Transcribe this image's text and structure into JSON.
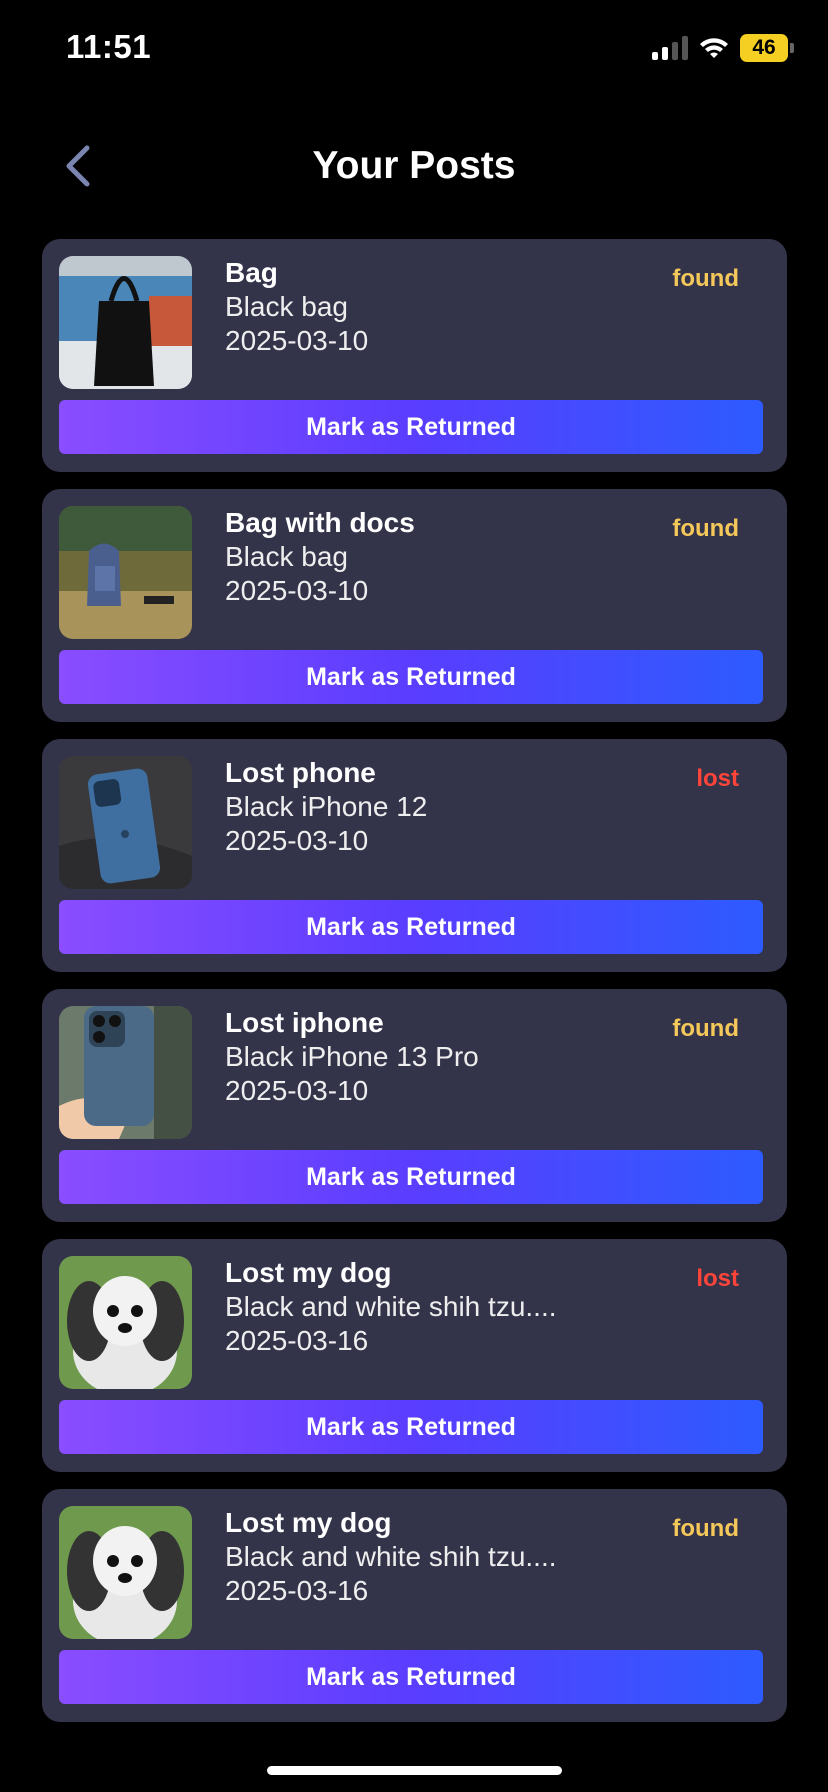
{
  "status_bar": {
    "time": "11:51",
    "battery": "46"
  },
  "header": {
    "title": "Your Posts"
  },
  "posts": [
    {
      "title": "Bag",
      "description": "Black bag",
      "date": "2025-03-10",
      "status": "found",
      "button_label": "Mark as Returned",
      "image": "black-handbag-photo"
    },
    {
      "title": "Bag with docs",
      "description": "Black bag",
      "date": "2025-03-10",
      "status": "found",
      "button_label": "Mark as Returned",
      "image": "backpack-on-grass-photo"
    },
    {
      "title": "Lost phone",
      "description": "Black iPhone 12",
      "date": "2025-03-10",
      "status": "lost",
      "button_label": "Mark as Returned",
      "image": "blue-iphone-photo"
    },
    {
      "title": "Lost iphone",
      "description": "Black iPhone 13 Pro",
      "date": "2025-03-10",
      "status": "found",
      "button_label": "Mark as Returned",
      "image": "iphone-in-hand-photo"
    },
    {
      "title": "Lost my dog",
      "description": "Black and white shih tzu....",
      "date": "2025-03-16",
      "status": "lost",
      "button_label": "Mark as Returned",
      "image": "shih-tzu-photo"
    },
    {
      "title": "Lost my dog",
      "description": "Black and white shih tzu....",
      "date": "2025-03-16",
      "status": "found",
      "button_label": "Mark as Returned",
      "image": "shih-tzu-photo"
    }
  ],
  "colors": {
    "card_bg": "#33334a",
    "found": "#f5c85a",
    "lost": "#ff453a",
    "button_start": "#8a4dff",
    "button_end": "#2d5bff"
  }
}
